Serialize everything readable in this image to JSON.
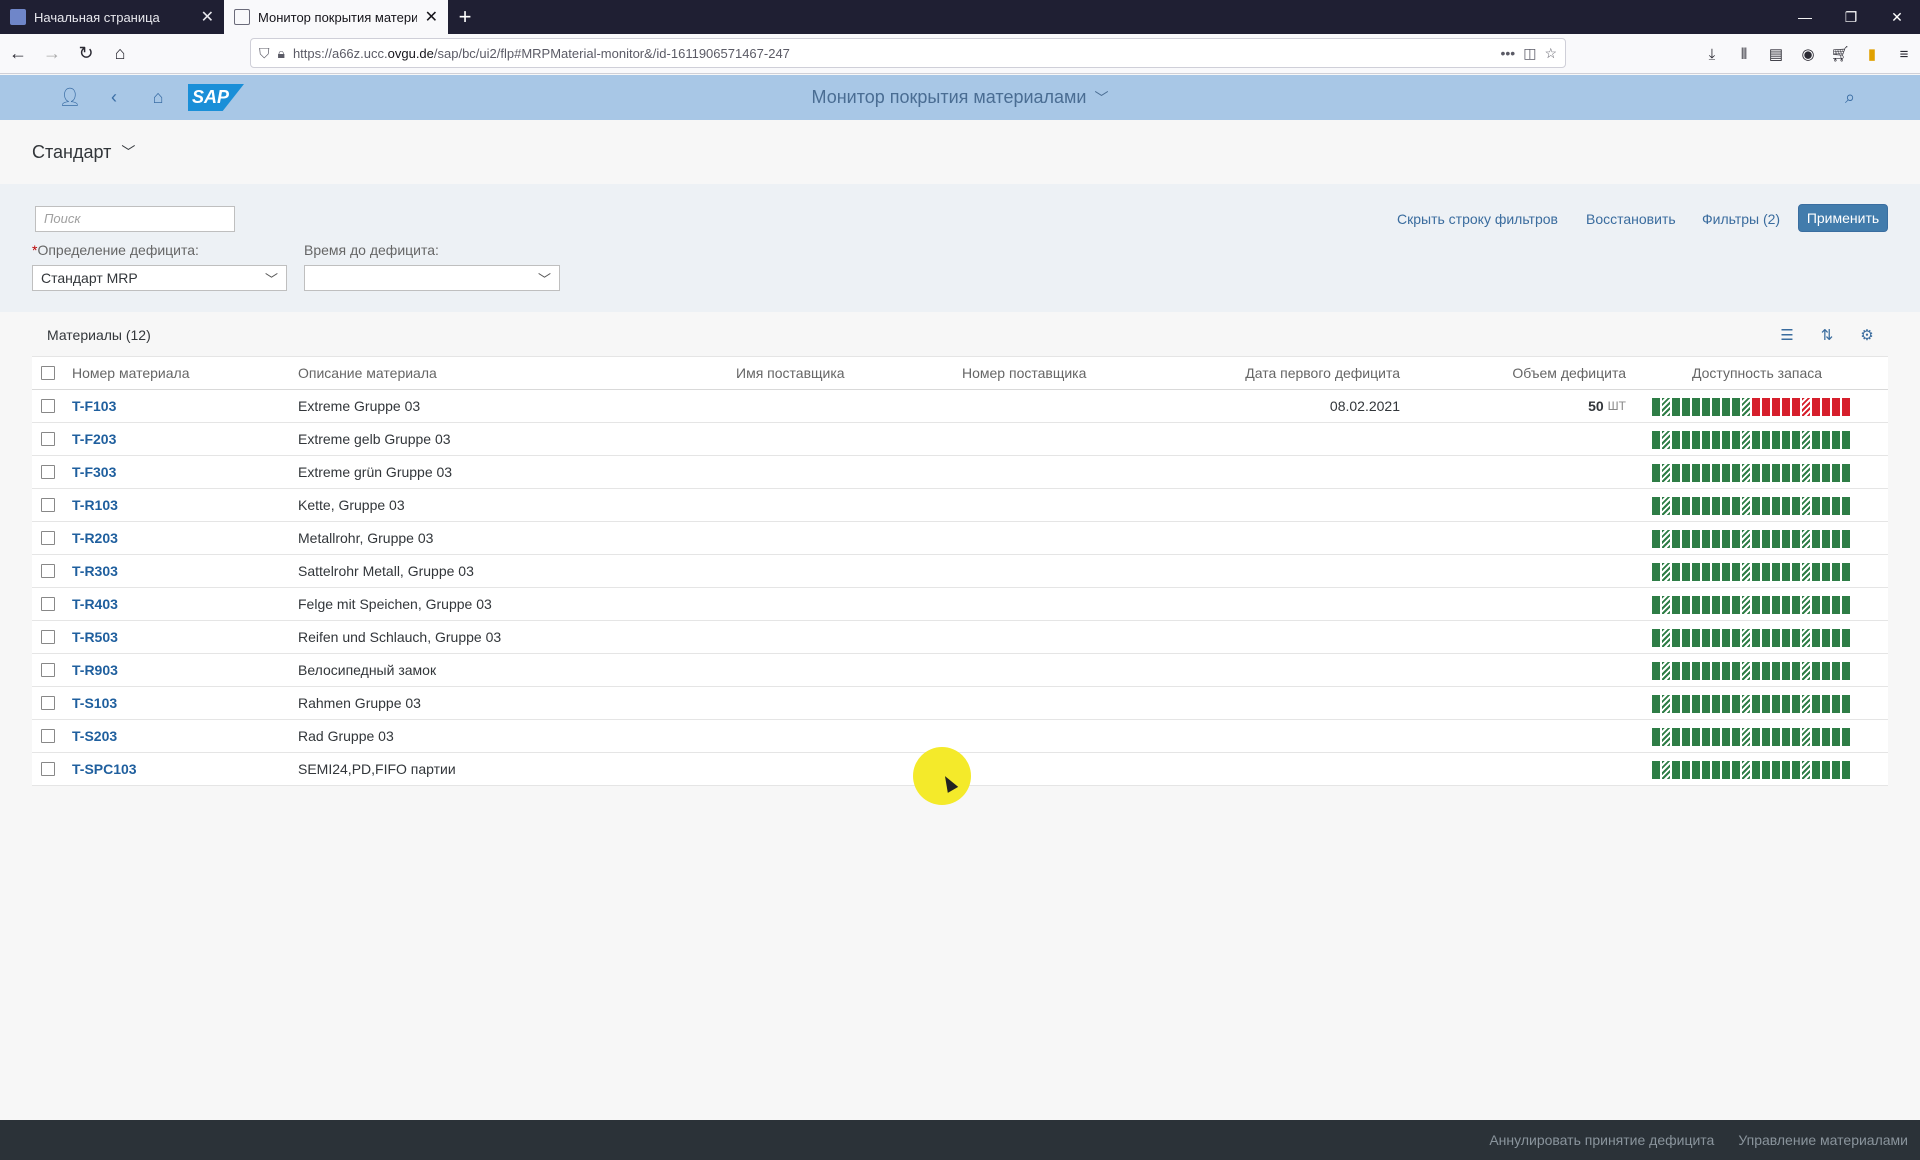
{
  "browser": {
    "tabs": [
      {
        "title": "Начальная страница"
      },
      {
        "title": "Монитор покрытия материал"
      }
    ],
    "url_prefix": "https://a66z.ucc.",
    "url_domain": "ovgu.de",
    "url_path": "/sap/bc/ui2/flp#MRPMaterial-monitor&/id-1611906571467-247"
  },
  "shell": {
    "title": "Монитор покрытия материалами",
    "logo": "SAP"
  },
  "variant": {
    "name": "Стандарт"
  },
  "filterbar": {
    "search_placeholder": "Поиск",
    "hide_label": "Скрыть строку фильтров",
    "restore_label": "Восстановить",
    "filters_label": "Фильтры (2)",
    "apply_label": "Применить",
    "field1_label": "Определение дефицита:",
    "field1_value": "Стандарт MRP",
    "field2_label": "Время до дефицита:",
    "field2_value": ""
  },
  "table": {
    "title": "Материалы (12)",
    "headers": {
      "material_no": "Номер материала",
      "description": "Описание материала",
      "supplier_name": "Имя поставщика",
      "supplier_no": "Номер поставщика",
      "first_shortage": "Дата первого дефицита",
      "shortage_qty": "Объем дефицита",
      "availability": "Доступность запаса"
    },
    "rows": [
      {
        "no": "T-F103",
        "desc": "Extreme Gruppe 03",
        "date": "08.02.2021",
        "qty": "50",
        "unit": "ШТ",
        "shortage": true
      },
      {
        "no": "T-F203",
        "desc": "Extreme gelb Gruppe 03",
        "date": "",
        "qty": "",
        "unit": "",
        "shortage": false
      },
      {
        "no": "T-F303",
        "desc": "Extreme grün Gruppe 03",
        "date": "",
        "qty": "",
        "unit": "",
        "shortage": false
      },
      {
        "no": "T-R103",
        "desc": "Kette, Gruppe 03",
        "date": "",
        "qty": "",
        "unit": "",
        "shortage": false
      },
      {
        "no": "T-R203",
        "desc": "Metallrohr, Gruppe 03",
        "date": "",
        "qty": "",
        "unit": "",
        "shortage": false
      },
      {
        "no": "T-R303",
        "desc": "Sattelrohr Metall, Gruppe 03",
        "date": "",
        "qty": "",
        "unit": "",
        "shortage": false
      },
      {
        "no": "T-R403",
        "desc": "Felge mit Speichen, Gruppe 03",
        "date": "",
        "qty": "",
        "unit": "",
        "shortage": false
      },
      {
        "no": "T-R503",
        "desc": "Reifen und Schlauch, Gruppe 03",
        "date": "",
        "qty": "",
        "unit": "",
        "shortage": false
      },
      {
        "no": "T-R903",
        "desc": "Велосипедный замок",
        "date": "",
        "qty": "",
        "unit": "",
        "shortage": false
      },
      {
        "no": "T-S103",
        "desc": "Rahmen Gruppe 03",
        "date": "",
        "qty": "",
        "unit": "",
        "shortage": false
      },
      {
        "no": "T-S203",
        "desc": "Rad Gruppe 03",
        "date": "",
        "qty": "",
        "unit": "",
        "shortage": false
      },
      {
        "no": "T-SPC103",
        "desc": "SEMI24,PD,FIFO партии",
        "date": "",
        "qty": "",
        "unit": "",
        "shortage": false
      }
    ]
  },
  "footer": {
    "action1": "Аннулировать принятие дефицита",
    "action2": "Управление материалами"
  },
  "colors": {
    "shell": "#a8c7e6",
    "available": "#2e7d46",
    "shortage": "#d61f2c",
    "link": "#1f5f9e",
    "apply": "#427cac"
  }
}
